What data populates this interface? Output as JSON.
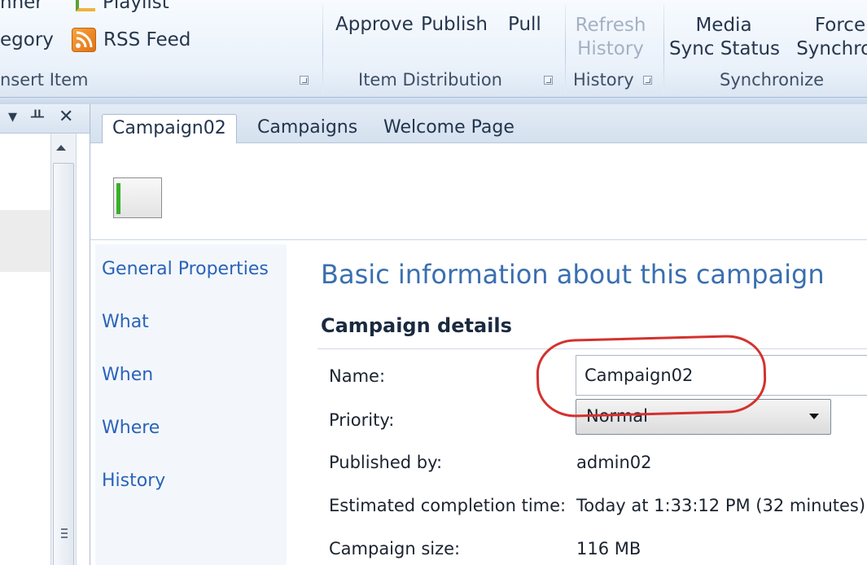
{
  "ribbon": {
    "groups": {
      "insert_item": {
        "label": "nsert Item",
        "items": {
          "banner": "nner",
          "playlist": "Playlist",
          "category": "egory",
          "rss_feed": "RSS Feed"
        }
      },
      "item_distribution": {
        "label": "Item Distribution",
        "buttons": {
          "approve": "Approve",
          "publish": "Publish",
          "pull": "Pull"
        }
      },
      "history": {
        "label": "History",
        "buttons": {
          "refresh_history_1": "Refresh",
          "refresh_history_2": "History"
        }
      },
      "synchronize": {
        "label": "Synchronize",
        "buttons": {
          "media_sync_1": "Media",
          "media_sync_2": "Sync Status",
          "force_sync_1": "Force",
          "force_sync_2": "Synchron"
        }
      }
    }
  },
  "left_pane": {
    "glyphs": {
      "dropdown": "▾",
      "pin": "ᚇ",
      "close": "✕"
    }
  },
  "tabs": [
    {
      "label": "Campaign02",
      "active": true
    },
    {
      "label": "Campaigns",
      "active": false
    },
    {
      "label": "Welcome Page",
      "active": false
    }
  ],
  "side_nav": {
    "items": [
      "General Properties",
      "What",
      "When",
      "Where",
      "History"
    ]
  },
  "content": {
    "section_title": "Basic information about this campaign",
    "sub_title": "Campaign details",
    "fields": {
      "name": {
        "label": "Name:",
        "value": "Campaign02"
      },
      "priority": {
        "label": "Priority:",
        "value": "Normal"
      },
      "published_by": {
        "label": "Published by:",
        "value": "admin02"
      },
      "completion": {
        "label": "Estimated completion time:",
        "value": "Today at 1:33:12 PM (32 minutes)"
      },
      "size": {
        "label": "Campaign size:",
        "value": "116 MB"
      }
    }
  },
  "colors": {
    "link": "#2a63b8",
    "title": "#3a6fb0",
    "highlight": "#d4312e",
    "progress": "#38b027"
  }
}
